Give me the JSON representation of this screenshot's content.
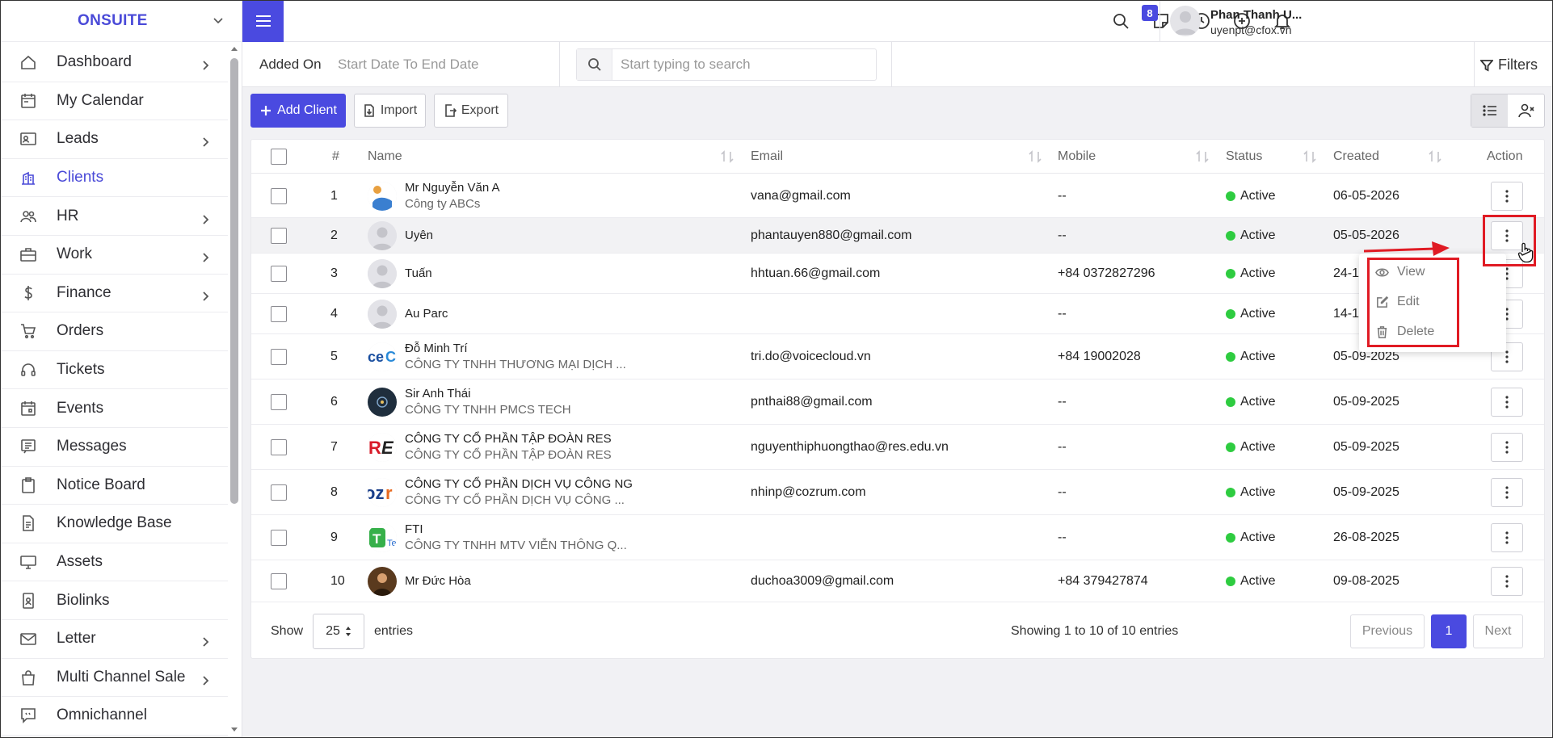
{
  "brand": {
    "name": "ONSUITE"
  },
  "sidebar": {
    "items": [
      {
        "label": "Dashboard",
        "icon": "home-icon",
        "has_arrow": true
      },
      {
        "label": "My Calendar",
        "icon": "calendar-icon",
        "has_arrow": false
      },
      {
        "label": "Leads",
        "icon": "id-card-icon",
        "has_arrow": true
      },
      {
        "label": "Clients",
        "icon": "building-icon",
        "has_arrow": false,
        "active": true
      },
      {
        "label": "HR",
        "icon": "people-icon",
        "has_arrow": true
      },
      {
        "label": "Work",
        "icon": "briefcase-icon",
        "has_arrow": true
      },
      {
        "label": "Finance",
        "icon": "dollar-icon",
        "has_arrow": true
      },
      {
        "label": "Orders",
        "icon": "cart-icon",
        "has_arrow": false
      },
      {
        "label": "Tickets",
        "icon": "headset-icon",
        "has_arrow": false
      },
      {
        "label": "Events",
        "icon": "calendar-event-icon",
        "has_arrow": false
      },
      {
        "label": "Messages",
        "icon": "message-icon",
        "has_arrow": false
      },
      {
        "label": "Notice Board",
        "icon": "clipboard-icon",
        "has_arrow": false
      },
      {
        "label": "Knowledge Base",
        "icon": "document-icon",
        "has_arrow": false
      },
      {
        "label": "Assets",
        "icon": "monitor-icon",
        "has_arrow": false
      },
      {
        "label": "Biolinks",
        "icon": "badge-icon",
        "has_arrow": false
      },
      {
        "label": "Letter",
        "icon": "envelope-icon",
        "has_arrow": true
      },
      {
        "label": "Multi Channel Sale",
        "icon": "bag-icon",
        "has_arrow": true
      },
      {
        "label": "Omnichannel",
        "icon": "chat-icon",
        "has_arrow": false
      }
    ]
  },
  "topbar": {
    "notification_count": "8",
    "user_name": "Phan Thanh U...",
    "user_email": "uyenpt@cfox.vn"
  },
  "filterbar": {
    "added_on_label": "Added On",
    "date_range_placeholder": "Start Date To End Date",
    "search_placeholder": "Start typing to search",
    "filters_label": "Filters"
  },
  "actions": {
    "add_client": "Add Client",
    "import": "Import",
    "export": "Export"
  },
  "table": {
    "columns": {
      "num": "#",
      "name": "Name",
      "email": "Email",
      "mobile": "Mobile",
      "status": "Status",
      "created": "Created",
      "action": "Action"
    },
    "rows": [
      {
        "num": "1",
        "name": "Mr Nguyễn Văn A",
        "company": "Công ty ABCs",
        "email": "vana@gmail.com",
        "mobile": "--",
        "status": "Active",
        "created": "06-05-2026"
      },
      {
        "num": "2",
        "name": "Uyên",
        "company": "",
        "email": "phantauyen880@gmail.com",
        "mobile": "--",
        "status": "Active",
        "created": "05-05-2026"
      },
      {
        "num": "3",
        "name": "Tuấn",
        "company": "",
        "email": "hhtuan.66@gmail.com",
        "mobile": "+84 0372827296",
        "status": "Active",
        "created": "24-1"
      },
      {
        "num": "4",
        "name": "Au Parc",
        "company": "",
        "email": "",
        "mobile": "--",
        "status": "Active",
        "created": "14-1"
      },
      {
        "num": "5",
        "name": "Đỗ Minh Trí",
        "company": "CÔNG TY TNHH THƯƠNG MẠI DỊCH ...",
        "email": "tri.do@voicecloud.vn",
        "mobile": "+84 19002028",
        "status": "Active",
        "created": "05-09-2025"
      },
      {
        "num": "6",
        "name": "Sir Anh Thái",
        "company": "CÔNG TY TNHH PMCS TECH",
        "email": "pnthai88@gmail.com",
        "mobile": "--",
        "status": "Active",
        "created": "05-09-2025"
      },
      {
        "num": "7",
        "name": "CÔNG TY CỔ PHẦN TẬP ĐOÀN RES",
        "company": "CÔNG TY CỔ PHẦN TẬP ĐOÀN RES",
        "email": "nguyenthiphuongthao@res.edu.vn",
        "mobile": "--",
        "status": "Active",
        "created": "05-09-2025"
      },
      {
        "num": "8",
        "name": "CÔNG TY CỔ PHẦN DỊCH VỤ CÔNG NG",
        "company": "CÔNG TY CỔ PHẦN DỊCH VỤ CÔNG ...",
        "email": "nhinp@cozrum.com",
        "mobile": "--",
        "status": "Active",
        "created": "05-09-2025"
      },
      {
        "num": "9",
        "name": "FTI",
        "company": "CÔNG TY TNHH MTV VIỄN THÔNG Q...",
        "email": "",
        "mobile": "--",
        "status": "Active",
        "created": "26-08-2025"
      },
      {
        "num": "10",
        "name": "Mr Đức Hòa",
        "company": "",
        "email": "duchoa3009@gmail.com",
        "mobile": "+84 379427874",
        "status": "Active",
        "created": "09-08-2025"
      }
    ]
  },
  "footer": {
    "show_label": "Show",
    "page_size": "25",
    "entries_label": "entries",
    "showing_text": "Showing 1 to 10 of 10 entries",
    "previous": "Previous",
    "current_page": "1",
    "next": "Next"
  },
  "dropdown": {
    "view": "View",
    "edit": "Edit",
    "delete": "Delete"
  },
  "colors": {
    "primary": "#4a4ae0",
    "active_status": "#2ecc40",
    "annotation": "#e01b24"
  }
}
